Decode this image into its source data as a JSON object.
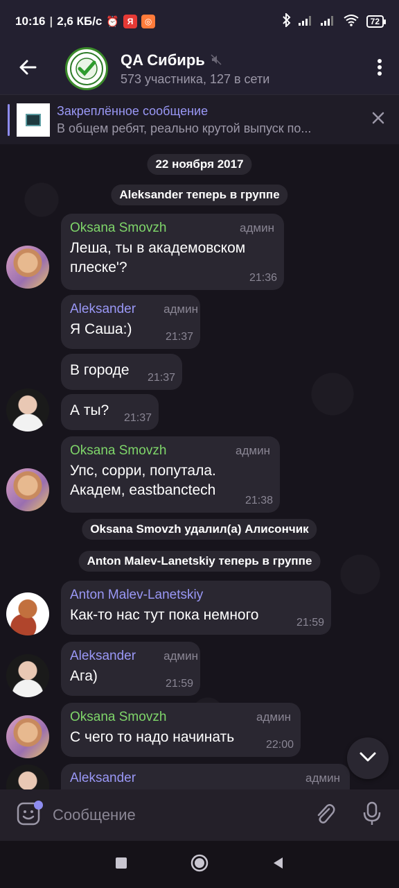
{
  "status_bar": {
    "time": "10:16",
    "speed": "2,6 КБ/с",
    "battery": "72"
  },
  "header": {
    "title": "QA Сибирь",
    "subtitle": "573 участника, 127 в сети"
  },
  "pinned": {
    "title": "Закреплённое сообщение",
    "text": "В общем ребят, реально крутой выпуск по..."
  },
  "chat": {
    "date": "22 ноября 2017",
    "join1": "Aleksander теперь в группе",
    "delete1": "Oksana Smovzh удалил(а) Алисончик",
    "join2": "Anton Malev-Lanetskiy теперь в группе",
    "messages": [
      {
        "sender": "Oksana Smovzh",
        "role": "админ",
        "lines": [
          "Леша, ты в академовском",
          "плеске'?"
        ],
        "time": "21:36"
      },
      {
        "sender": "Aleksander",
        "role": "админ",
        "lines": [
          "Я Саша:)"
        ],
        "time": "21:37"
      },
      {
        "sender": "",
        "role": "",
        "lines": [
          "В городе"
        ],
        "time": "21:37"
      },
      {
        "sender": "",
        "role": "",
        "lines": [
          "А ты?"
        ],
        "time": "21:37"
      },
      {
        "sender": "Oksana Smovzh",
        "role": "админ",
        "lines": [
          "Упс, сорри, попутала.",
          "Академ, eastbanctech"
        ],
        "time": "21:38"
      },
      {
        "sender": "Anton Malev-Lanetskiy",
        "role": "",
        "lines": [
          "Как-то нас тут пока немного"
        ],
        "time": "21:59"
      },
      {
        "sender": "Aleksander",
        "role": "админ",
        "lines": [
          "Ага)"
        ],
        "time": "21:59"
      },
      {
        "sender": "Oksana Smovzh",
        "role": "админ",
        "lines": [
          "С чего то надо начинать"
        ],
        "time": "22:00"
      },
      {
        "sender": "Aleksander",
        "role": "админ",
        "lines": [],
        "time": ""
      }
    ]
  },
  "input": {
    "placeholder": "Сообщение"
  },
  "icons": {
    "back": "arrow-left-icon",
    "menu": "more-vertical-icon",
    "mute": "muted-icon",
    "close": "close-icon",
    "emoji": "sticker-icon",
    "attach": "paperclip-icon",
    "mic": "microphone-icon",
    "scroll_down": "chevron-down-icon"
  },
  "colors": {
    "accent": "#9a98f6",
    "admin_green": "#7fd66a",
    "bubble": "#2a2731"
  }
}
